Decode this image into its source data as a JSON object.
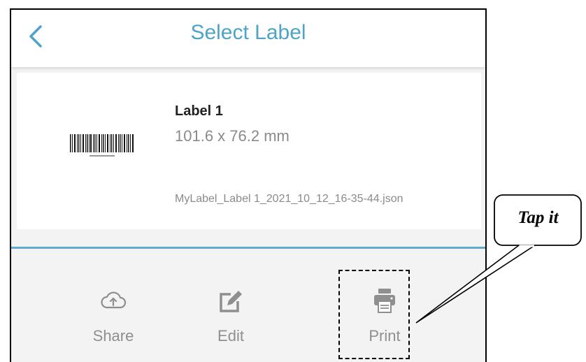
{
  "header": {
    "title": "Select Label",
    "back_icon": "chevron-left-icon"
  },
  "label": {
    "name": "Label 1",
    "size": "101.6 x 76.2 mm",
    "file": "MyLabel_Label 1_2021_10_12_16-35-44.json"
  },
  "actions": [
    {
      "label": "Share",
      "icon": "cloud-upload-icon"
    },
    {
      "label": "Edit",
      "icon": "edit-icon"
    },
    {
      "label": "Print",
      "icon": "printer-icon"
    }
  ],
  "annotation": {
    "text": "Tap it"
  },
  "colors": {
    "accent": "#4da3c8",
    "divider": "#5fa9cf",
    "muted": "#8f8f8f"
  }
}
